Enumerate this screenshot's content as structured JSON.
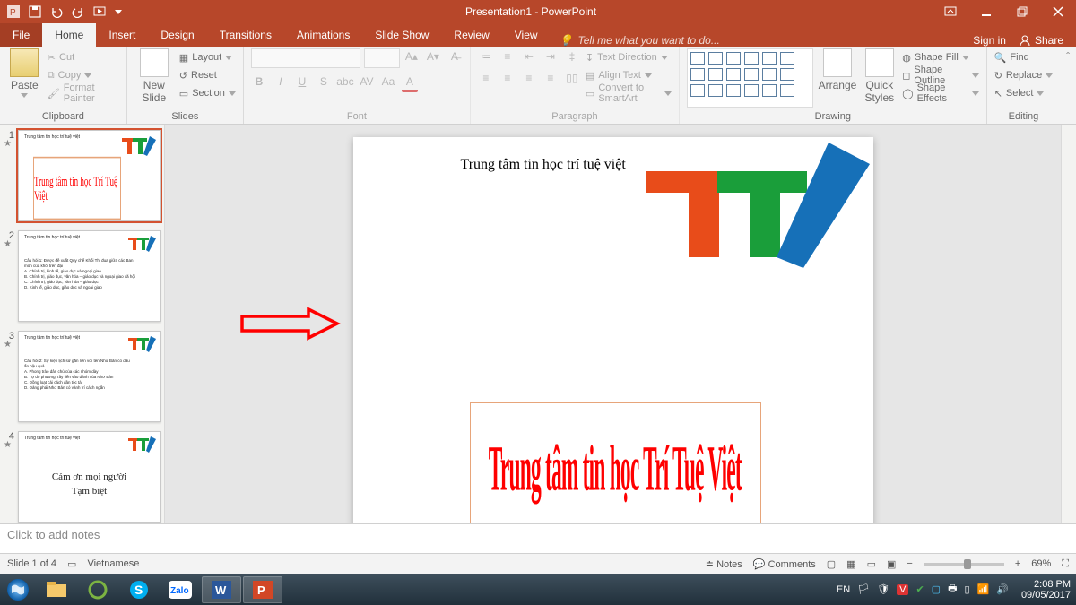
{
  "title": "Presentation1 - PowerPoint",
  "tabs": {
    "file": "File",
    "home": "Home",
    "insert": "Insert",
    "design": "Design",
    "transitions": "Transitions",
    "animations": "Animations",
    "slideshow": "Slide Show",
    "review": "Review",
    "view": "View"
  },
  "tellme": "Tell me what you want to do...",
  "signin": "Sign in",
  "share": "Share",
  "ribbon": {
    "clipboard": {
      "label": "Clipboard",
      "paste": "Paste",
      "cut": "Cut",
      "copy": "Copy",
      "formatpainter": "Format Painter"
    },
    "slides": {
      "label": "Slides",
      "newslide": "New\nSlide",
      "layout": "Layout",
      "reset": "Reset",
      "section": "Section"
    },
    "font": {
      "label": "Font"
    },
    "paragraph": {
      "label": "Paragraph",
      "textdir": "Text Direction",
      "align": "Align Text",
      "smartart": "Convert to SmartArt"
    },
    "drawing": {
      "label": "Drawing",
      "arrange": "Arrange",
      "quick": "Quick\nStyles",
      "fill": "Shape Fill",
      "outline": "Shape Outline",
      "effects": "Shape Effects"
    },
    "editing": {
      "label": "Editing",
      "find": "Find",
      "replace": "Replace",
      "select": "Select"
    }
  },
  "slides_panel": [
    {
      "n": "1",
      "title": "Trung tâm tin học trí tuệ việt",
      "wordart": "Trung tâm tin học Trí Tuệ Việt"
    },
    {
      "n": "2",
      "title": "Trung tâm tin học trí tuệ việt",
      "body": "Câu hỏi 1: Được đề xuất Quy chế Khối Thi đua giữa các Ban\nmôn của khối trên đại\nA. Chính trị, kinh tế, giáo dục và ngoại giao\nB. Chính trị, giáo dục, văn hóa – giáo dục và ngoại giao xã hội\nC. Chính trị, giáo dục, văn hóa – giáo dục\nD. Kinh tế, giáo dục, giáo dục và ngoại giao"
    },
    {
      "n": "3",
      "title": "Trung tâm tin học trí tuệ việt",
      "body": "Câu hỏi 2: Sự kiện lịch sử gắn liền với tên Nhơ Bản có dấu\nấn hậu quả\nA. Phong trào dân chủ của các nhóm dày\nB. Tự do phương Tây tiến vào đánh của Nhơ Bản\nC. Đồng loạt cải cách dân tộc tài\nD. Đảng phái Nhơ Bản có vành trí cách ngắn"
    },
    {
      "n": "4",
      "title": "Trung tâm tin học trí tuệ việt",
      "body1": "Cảm ơn mọi người",
      "body2": "Tạm biệt"
    }
  ],
  "main_slide": {
    "title": "Trung tâm tin học trí tuệ việt",
    "wordart": "Trung tâm tin học Trí Tuệ Việt"
  },
  "notes_placeholder": "Click to add notes",
  "status": {
    "slide": "Slide 1 of 4",
    "lang": "Vietnamese",
    "notes": "Notes",
    "comments": "Comments",
    "zoom": "69%"
  },
  "tray": {
    "lang": "EN",
    "time": "2:08 PM",
    "date": "09/05/2017"
  }
}
